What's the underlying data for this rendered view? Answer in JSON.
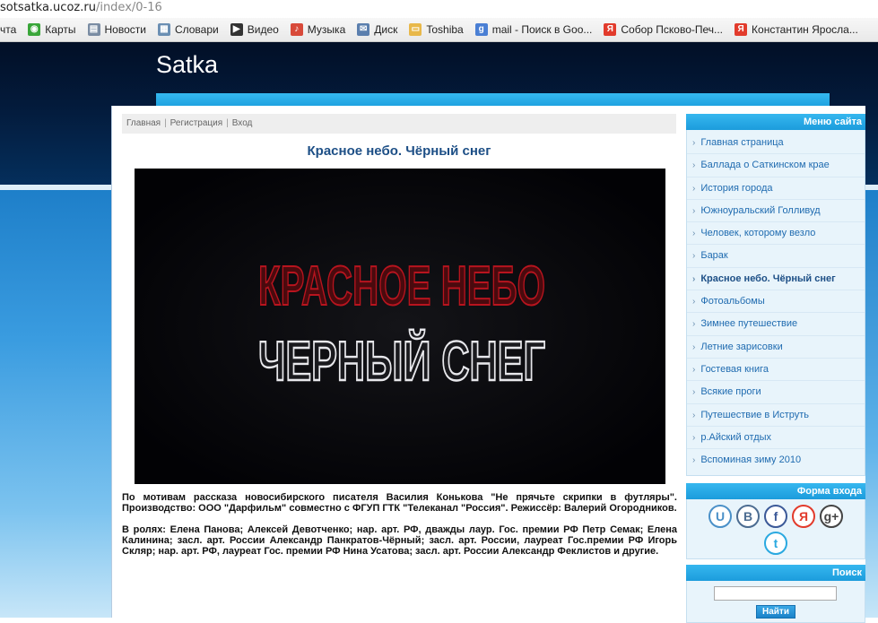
{
  "browser": {
    "url_host": "sotsatka.ucoz.ru",
    "url_path": "/index/0-16",
    "bookmarks": [
      {
        "label": "чта",
        "icon": "none"
      },
      {
        "label": "Карты",
        "icon": "maps-icon"
      },
      {
        "label": "Новости",
        "icon": "page-icon"
      },
      {
        "label": "Словари",
        "icon": "dictionary-icon"
      },
      {
        "label": "Видео",
        "icon": "play-icon"
      },
      {
        "label": "Музыка",
        "icon": "music-icon"
      },
      {
        "label": "Диск",
        "icon": "mail-icon"
      },
      {
        "label": "Toshiba",
        "icon": "folder-icon"
      },
      {
        "label": "mail - Поиск в Goo...",
        "icon": "google-icon"
      },
      {
        "label": "Собор Псково-Печ...",
        "icon": "yandex-icon"
      },
      {
        "label": "Константин Яросла...",
        "icon": "yandex-icon"
      }
    ]
  },
  "site": {
    "title": "Satka"
  },
  "breadcrumb": {
    "items": [
      "Главная",
      "Регистрация",
      "Вход"
    ],
    "separator": "|"
  },
  "article": {
    "title": "Красное небо. Чёрный снег",
    "video_title_line1": "КРАСНОЕ НЕБО",
    "video_title_line2": "ЧЕРНЫЙ СНЕГ",
    "paragraph1": "По мотивам рассказа новосибирского писателя Василия Конькова \"Не прячьте скрипки в футляры\". Производство: ООО \"Дарфильм\" совместно с ФГУП ГТК \"Телеканал \"Россия\". Режиссёр: Валерий Огородников.",
    "paragraph2": "В ролях: Елена Панова; Алексей Девотченко; нар. арт. РФ, дважды лаур. Гос. премии РФ Петр Семак; Елена Калинина; засл. арт. России Александр Панкратов-Чёрный; засл. арт. России, лауреат Гос.премии РФ Игорь Скляр; нар. арт. РФ, лауреат Гос. премии РФ Нина Усатова; засл. арт. России Александр Феклистов и другие."
  },
  "sidebar": {
    "menu_title": "Меню сайта",
    "menu_items": [
      {
        "label": "Главная страница",
        "active": false
      },
      {
        "label": "Баллада о Саткинском крае",
        "active": false
      },
      {
        "label": "История города",
        "active": false
      },
      {
        "label": "Южноуральский Голливуд",
        "active": false
      },
      {
        "label": "Человек, которому везло",
        "active": false
      },
      {
        "label": "Барак",
        "active": false
      },
      {
        "label": "Красное небо. Чёрный снег",
        "active": true
      },
      {
        "label": "Фотоальбомы",
        "active": false
      },
      {
        "label": "Зимнее путешествие",
        "active": false
      },
      {
        "label": "Летние зарисовки",
        "active": false
      },
      {
        "label": "Гостевая книга",
        "active": false
      },
      {
        "label": "Всякие проги",
        "active": false
      },
      {
        "label": "Путешествие в Иструть",
        "active": false
      },
      {
        "label": "р.Айский отдых",
        "active": false
      },
      {
        "label": "Вспоминая зиму 2010",
        "active": false
      }
    ],
    "login_title": "Форма входа",
    "socials": [
      {
        "glyph": "U",
        "icon": "ucoz-icon",
        "color": "#4a90c8"
      },
      {
        "glyph": "B",
        "icon": "vk-icon",
        "color": "#4c6c91"
      },
      {
        "glyph": "f",
        "icon": "facebook-icon",
        "color": "#3b5998"
      },
      {
        "glyph": "Я",
        "icon": "yandex-icon",
        "color": "#e23b2c"
      },
      {
        "glyph": "g+",
        "icon": "google-plus-icon",
        "color": "#444444"
      },
      {
        "glyph": "t",
        "icon": "twitter-icon",
        "color": "#2aa9e0"
      }
    ],
    "search_title": "Поиск",
    "search_button": "Найти"
  },
  "colors": {
    "accent": "#1fa2e0",
    "link": "#1f6bb0",
    "title": "#1d4f86"
  }
}
